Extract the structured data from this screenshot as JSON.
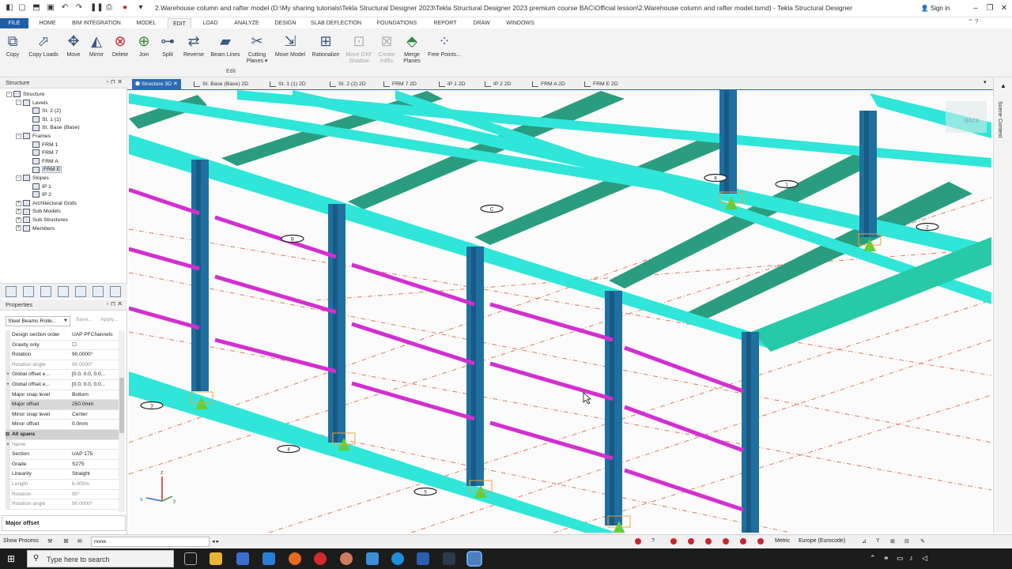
{
  "window": {
    "title": "2.Warehouse column and rafter model (D:\\My sharing tutorials\\Tekla Structural Designer 2023\\Tekla Structural Designer 2023 premium course BAC\\Official lesson\\2.Warehouse column and rafter model.tsmd) - Tekla Structural Designer",
    "sign_in": "Sign in"
  },
  "ribbon_tabs": [
    "FILE",
    "HOME",
    "BIM INTEGRATION",
    "MODEL",
    "EDIT",
    "LOAD",
    "ANALYZE",
    "DESIGN",
    "SLAB DEFLECTION",
    "FOUNDATIONS",
    "REPORT",
    "DRAW",
    "WINDOWS"
  ],
  "active_ribbon_tab": "EDIT",
  "ribbon_tools": [
    {
      "label": "Copy",
      "icon": "copy-icon"
    },
    {
      "label": "Copy Loads",
      "icon": "copy-loads-icon"
    },
    {
      "label": "Move",
      "icon": "move-icon"
    },
    {
      "label": "Mirror",
      "icon": "mirror-icon"
    },
    {
      "label": "Delete",
      "icon": "delete-icon"
    },
    {
      "label": "Join",
      "icon": "join-icon"
    },
    {
      "label": "Split",
      "icon": "split-icon"
    },
    {
      "label": "Reverse",
      "icon": "reverse-icon"
    },
    {
      "label": "Beam Lines",
      "icon": "beam-lines-icon"
    },
    {
      "label": "Cutting Planes",
      "icon": "cutting-planes-icon"
    },
    {
      "label": "Move Model",
      "icon": "move-model-icon"
    },
    {
      "label": "Rationalize",
      "icon": "rationalize-icon"
    },
    {
      "label": "Move DXF Shadow",
      "icon": "move-dxf-icon",
      "disabled": true
    },
    {
      "label": "Create Infills",
      "icon": "create-infills-icon",
      "disabled": true
    },
    {
      "label": "Merge Planes",
      "icon": "merge-planes-icon"
    },
    {
      "label": "Free Points...",
      "icon": "free-points-icon"
    }
  ],
  "ribbon_group_label": "Edit",
  "structure_panel": {
    "title": "Structure",
    "tree": [
      {
        "label": "Structure",
        "level": 0,
        "exp": "-"
      },
      {
        "label": "Levels",
        "level": 1,
        "exp": "-"
      },
      {
        "label": "St. 2 (2)",
        "level": 2
      },
      {
        "label": "St. 1 (1)",
        "level": 2
      },
      {
        "label": "St. Base (Base)",
        "level": 2
      },
      {
        "label": "Frames",
        "level": 1,
        "exp": "-"
      },
      {
        "label": "FRM 1",
        "level": 2
      },
      {
        "label": "FRM 7",
        "level": 2
      },
      {
        "label": "FRM A",
        "level": 2
      },
      {
        "label": "FRM E",
        "level": 2,
        "selected": true
      },
      {
        "label": "Slopes",
        "level": 1,
        "exp": "-"
      },
      {
        "label": "IP 1",
        "level": 2
      },
      {
        "label": "IP 2",
        "level": 2
      },
      {
        "label": "Architectural Grids",
        "level": 1,
        "exp": "+"
      },
      {
        "label": "Sub Models",
        "level": 1,
        "exp": "+"
      },
      {
        "label": "Sub Structures",
        "level": 1,
        "exp": "+"
      },
      {
        "label": "Members",
        "level": 1,
        "exp": "+"
      }
    ]
  },
  "properties_panel": {
    "title": "Properties",
    "selector": "Steel Beams Rolle...",
    "save": "Save...",
    "apply": "Apply...",
    "rows": [
      {
        "k": "Design section order",
        "v": "UAP PFChannels"
      },
      {
        "k": "Gravity only",
        "v": "☐"
      },
      {
        "k": "Rotation",
        "v": "90.0000°"
      },
      {
        "k": "Rotation angle",
        "v": "90.0000°",
        "dim": true
      },
      {
        "k": "Global offset e...",
        "v": "[0.0, 0.0, 0.0...",
        "exp": "+"
      },
      {
        "k": "Global offset e...",
        "v": "[0.0, 0.0, 0.0...",
        "exp": "+"
      },
      {
        "k": "Major snap level",
        "v": "Bottom"
      },
      {
        "k": "Major offset",
        "v": "250.0mm",
        "hl": true
      },
      {
        "k": "Minor snap level",
        "v": "Center"
      },
      {
        "k": "Minor offset",
        "v": "0.0mm"
      },
      {
        "k": "All spans",
        "v": "",
        "section": true
      },
      {
        "k": "Name",
        "v": "",
        "exp": "+",
        "dim": true
      },
      {
        "k": "Section",
        "v": "UAP 175"
      },
      {
        "k": "Grade",
        "v": "S275"
      },
      {
        "k": "Linearity",
        "v": "Straight"
      },
      {
        "k": "Length",
        "v": "6.000m",
        "dim": true
      },
      {
        "k": "Rotation",
        "v": "90°",
        "dim": true
      },
      {
        "k": "Rotation angle",
        "v": "90.0000°",
        "dim": true
      }
    ],
    "description_title": "Major offset"
  },
  "doc_tabs": [
    "Structure 3D",
    "St. Base (Base) 2D",
    "St. 1 (1) 2D",
    "St. 2 (2) 2D",
    "FRM 7 2D",
    "IP 1 2D",
    "IP 2 2D",
    "FRM A 2D",
    "FRM E 2D"
  ],
  "active_doc_tab": "Structure 3D",
  "viewport": {
    "grid_labels": [
      "B",
      "C",
      "1",
      "2",
      "3",
      "4",
      "5",
      "6"
    ],
    "axis_labels": {
      "x": "x",
      "y": "y",
      "z": "z"
    },
    "viewcube_label": "BACK",
    "colors": {
      "rafter": "#2fe6d9",
      "purlin_dark": "#2a9d80",
      "column": "#1f6fa0",
      "girt": "#d22fd0",
      "grid": "#e07a5f"
    }
  },
  "right_strip": {
    "label": "Scene Content"
  },
  "status_bar": {
    "show_process": "Show Process",
    "input_value": "none",
    "metric": "Metric",
    "code": "Europe (Eurocode)"
  },
  "taskbar": {
    "search_placeholder": "Type here to search"
  }
}
